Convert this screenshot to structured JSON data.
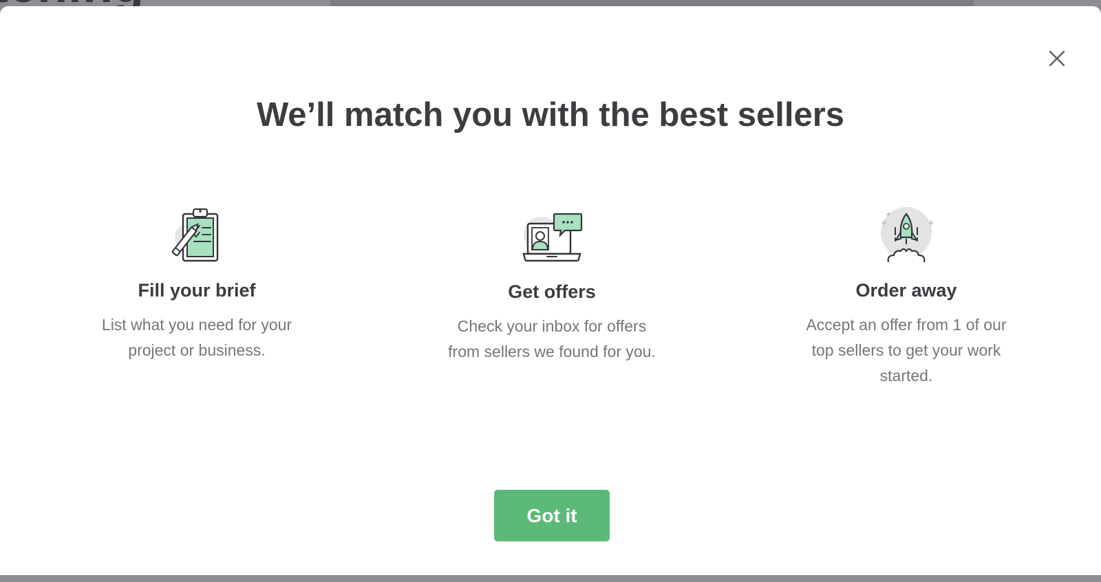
{
  "background": {
    "partial_heading": "tching"
  },
  "modal": {
    "close_icon": "close-icon",
    "title": "We’ll match you with the best sellers",
    "steps": [
      {
        "icon": "clipboard-checklist-icon",
        "title": "Fill your brief",
        "description": "List what you need for your project or business."
      },
      {
        "icon": "laptop-chat-icon",
        "title": "Get offers",
        "description": "Check your inbox for offers from sellers we found for you."
      },
      {
        "icon": "rocket-launch-icon",
        "title": "Order away",
        "description": "Accept an offer from 1 of our top sellers to get your work started."
      }
    ],
    "button_label": "Got it"
  },
  "colors": {
    "accent": "#5cba78",
    "icon_accent": "#a8e0c0",
    "title_text": "#3c3c41",
    "body_text": "#75757a",
    "overlay": "#8e8f92"
  }
}
